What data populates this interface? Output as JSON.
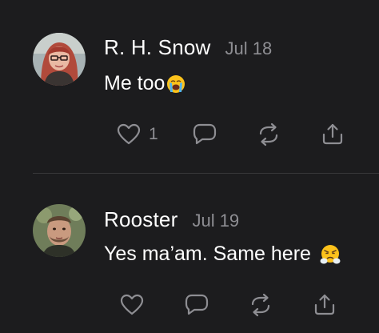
{
  "posts": [
    {
      "author": "R. H. Snow",
      "date": "Jul 18",
      "text": "Me too",
      "emoji_icon": "loudly-crying-face-icon",
      "like_count": "1"
    },
    {
      "author": "Rooster",
      "date": "Jul 19",
      "text": "Yes ma’am. Same here",
      "emoji_icon": "face-with-steam-icon"
    }
  ],
  "colors": {
    "background": "#1c1c1e",
    "text": "#ffffff",
    "secondary": "#8e8e93",
    "divider": "#38383a"
  }
}
